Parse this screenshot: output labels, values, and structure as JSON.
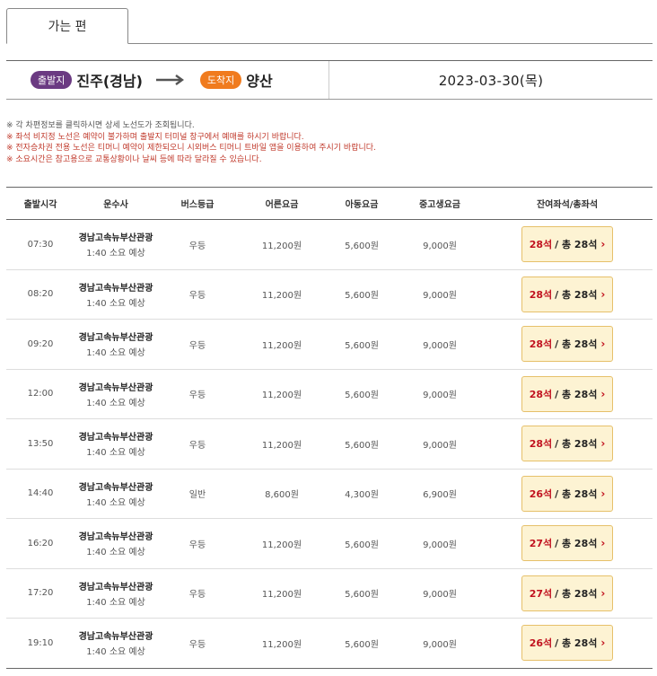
{
  "tab": {
    "label": "가는 편"
  },
  "route": {
    "departure_badge": "출발지",
    "departure_city": "진주(경남)",
    "arrival_badge": "도착지",
    "arrival_city": "양산",
    "date": "2023-03-30(목)"
  },
  "notes": [
    {
      "text": "※ 각 차편정보를 클릭하시면 상세 노선도가 조회됩니다.",
      "color": "dark"
    },
    {
      "text": "※ 좌석 비지정 노선은 예약이 불가하며 출발지 터미널 창구에서 예매를 하시기 바랍니다.",
      "color": "red"
    },
    {
      "text": "※ 전자승차권 전용 노선은 티머니 예약이 제한되오니 시외버스 티머니 트바일 앱을 이용하여 주시기 바랍니다.",
      "color": "red"
    },
    {
      "text": "※ 소요시간은 참고용으로 교통상황이나 날씨 등에 따라 달라질 수 있습니다.",
      "color": "red"
    }
  ],
  "table": {
    "headers": [
      "출발시각",
      "운수사",
      "버스등급",
      "어른요금",
      "아동요금",
      "중고생요금",
      "잔여좌석/총좌석"
    ],
    "rows": [
      {
        "time": "07:30",
        "company": "경남고속뉴부산관광",
        "duration": "1:40 소요 예상",
        "grade": "우등",
        "adult": "11,200원",
        "child": "5,600원",
        "student": "9,000원",
        "seats_left": "28석",
        "seats_total": "/ 총 28석"
      },
      {
        "time": "08:20",
        "company": "경남고속뉴부산관광",
        "duration": "1:40 소요 예상",
        "grade": "우등",
        "adult": "11,200원",
        "child": "5,600원",
        "student": "9,000원",
        "seats_left": "28석",
        "seats_total": "/ 총 28석"
      },
      {
        "time": "09:20",
        "company": "경남고속뉴부산관광",
        "duration": "1:40 소요 예상",
        "grade": "우등",
        "adult": "11,200원",
        "child": "5,600원",
        "student": "9,000원",
        "seats_left": "28석",
        "seats_total": "/ 총 28석"
      },
      {
        "time": "12:00",
        "company": "경남고속뉴부산관광",
        "duration": "1:40 소요 예상",
        "grade": "우등",
        "adult": "11,200원",
        "child": "5,600원",
        "student": "9,000원",
        "seats_left": "28석",
        "seats_total": "/ 총 28석"
      },
      {
        "time": "13:50",
        "company": "경남고속뉴부산관광",
        "duration": "1:40 소요 예상",
        "grade": "우등",
        "adult": "11,200원",
        "child": "5,600원",
        "student": "9,000원",
        "seats_left": "28석",
        "seats_total": "/ 총 28석"
      },
      {
        "time": "14:40",
        "company": "경남고속뉴부산관광",
        "duration": "1:40 소요 예상",
        "grade": "일반",
        "adult": "8,600원",
        "child": "4,300원",
        "student": "6,900원",
        "seats_left": "26석",
        "seats_total": "/ 총 28석"
      },
      {
        "time": "16:20",
        "company": "경남고속뉴부산관광",
        "duration": "1:40 소요 예상",
        "grade": "우등",
        "adult": "11,200원",
        "child": "5,600원",
        "student": "9,000원",
        "seats_left": "27석",
        "seats_total": "/ 총 28석"
      },
      {
        "time": "17:20",
        "company": "경남고속뉴부산관광",
        "duration": "1:40 소요 예상",
        "grade": "우등",
        "adult": "11,200원",
        "child": "5,600원",
        "student": "9,000원",
        "seats_left": "27석",
        "seats_total": "/ 총 28석"
      },
      {
        "time": "19:10",
        "company": "경남고속뉴부산관광",
        "duration": "1:40 소요 예상",
        "grade": "우등",
        "adult": "11,200원",
        "child": "5,600원",
        "student": "9,000원",
        "seats_left": "26석",
        "seats_total": "/ 총 28석"
      }
    ]
  },
  "icons": {
    "route_arrow": "right-arrow-icon",
    "seat_chevron": "chevron-right-icon"
  },
  "colors": {
    "departure_badge": "#6b3a82",
    "arrival_badge": "#f07b1e",
    "seat_left": "#c1121f",
    "seat_button_bg": "#fdf3d3",
    "note_red": "#c0392b"
  }
}
